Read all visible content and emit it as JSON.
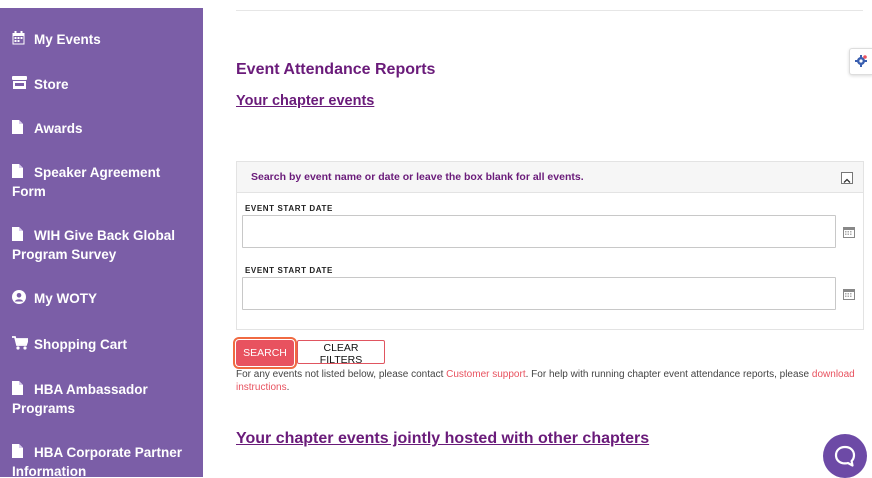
{
  "sidebar": {
    "items": [
      {
        "label": "My Events",
        "icon": "calendar-icon"
      },
      {
        "label": "Store",
        "icon": "store-icon"
      },
      {
        "label": "Awards",
        "icon": "file-icon"
      },
      {
        "label": "Speaker Agreement Form",
        "icon": "file-icon"
      },
      {
        "label": "WIH Give Back Global Program Survey",
        "icon": "file-icon"
      },
      {
        "label": "My WOTY",
        "icon": "user-circle-icon"
      },
      {
        "label": "Shopping Cart",
        "icon": "cart-icon"
      },
      {
        "label": "HBA Ambassador Programs",
        "icon": "file-icon"
      },
      {
        "label": "HBA Corporate Partner Information",
        "icon": "file-icon"
      }
    ]
  },
  "main": {
    "title": "Event Attendance Reports",
    "chapter_events_link": "Your chapter events",
    "search_panel": {
      "header": "Search by event name or date or leave the box blank for all events.",
      "field1_label": "EVENT START DATE",
      "field1_value": "",
      "field2_label": "EVENT START DATE",
      "field2_value": ""
    },
    "search_label": "SEARCH",
    "clear_label": "CLEAR FILTERS",
    "info": {
      "part1": "For any events not listed below, please contact ",
      "support_link": "Customer support",
      "part2": ". For help with running chapter event attendance reports, please ",
      "instructions_link": "download instructions",
      "part3": "."
    },
    "joint_link": "Your chapter events jointly hosted with other chapters"
  },
  "colors": {
    "sidebar_bg": "#7b5ea7",
    "title_purple": "#6a1b7a",
    "accent_red": "#e8525f",
    "chat_purple": "#6d4aa6"
  }
}
